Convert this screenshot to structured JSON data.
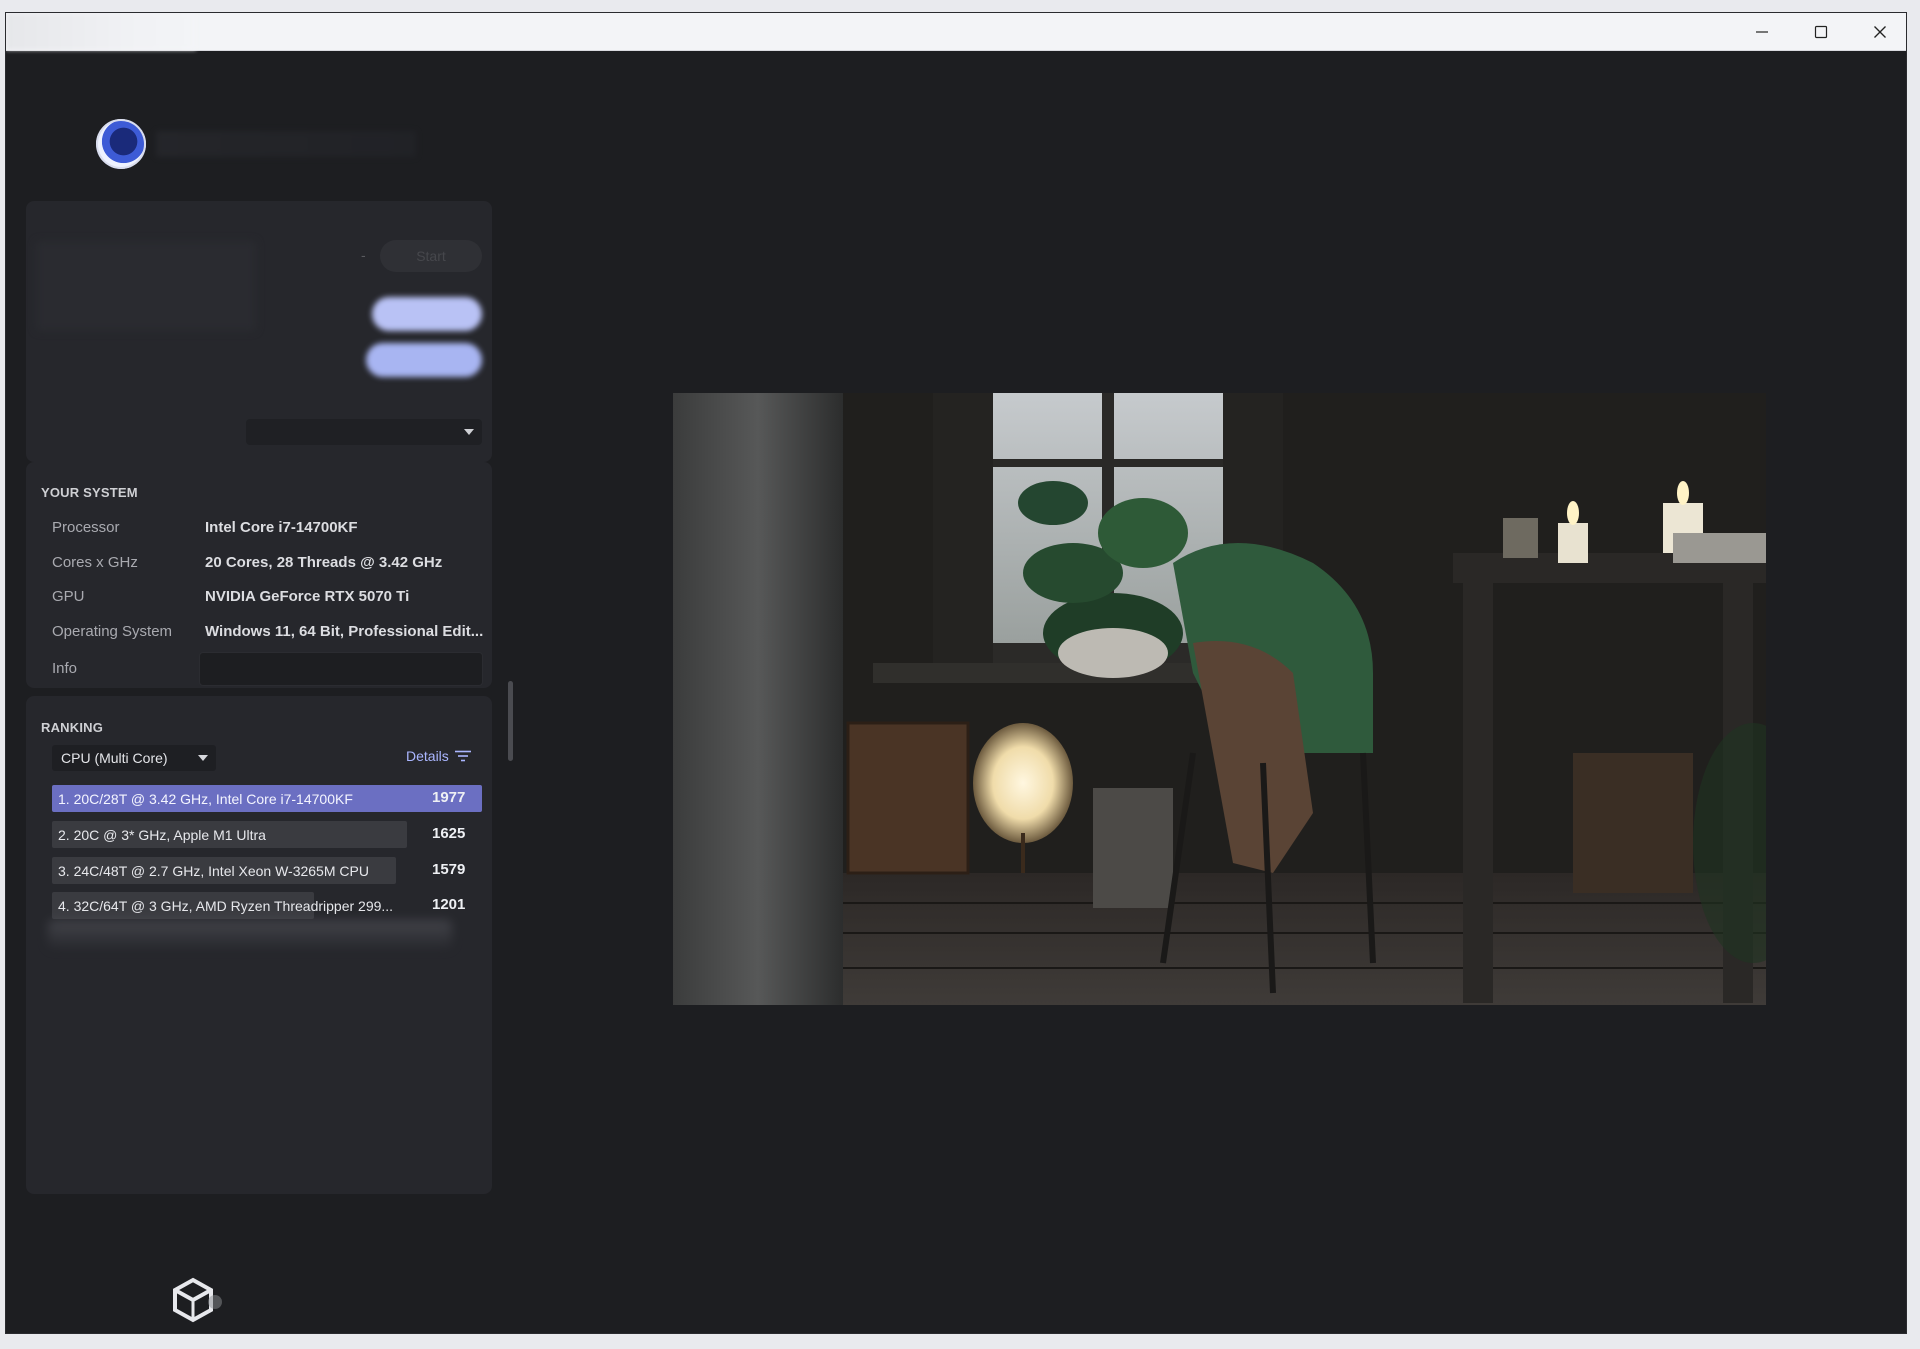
{
  "window": {
    "controls": {
      "minimize": "─",
      "maximize": "☐",
      "close": "✕"
    }
  },
  "controls_panel": {
    "dash": "-",
    "start_label": "Start"
  },
  "system": {
    "title": "YOUR SYSTEM",
    "rows": [
      {
        "label": "Processor",
        "value": "Intel Core i7-14700KF"
      },
      {
        "label": "Cores x GHz",
        "value": "20 Cores, 28 Threads @ 3.42 GHz"
      },
      {
        "label": "GPU",
        "value": "NVIDIA GeForce RTX 5070 Ti"
      },
      {
        "label": "Operating System",
        "value": "Windows 11, 64 Bit, Professional Edit..."
      },
      {
        "label": "Info",
        "value": ""
      }
    ]
  },
  "ranking": {
    "title": "RANKING",
    "mode": "CPU (Multi Core)",
    "details_label": "Details",
    "entries": [
      {
        "text": "1. 20C/28T @ 3.42 GHz, Intel Core i7-14700KF",
        "score": "1977",
        "score_value": 1977,
        "selected": true
      },
      {
        "text": "2. 20C @ 3* GHz, Apple M1 Ultra",
        "score": "1625",
        "score_value": 1625,
        "selected": false
      },
      {
        "text": "3. 24C/48T @ 2.7 GHz, Intel Xeon W-3265M CPU",
        "score": "1579",
        "score_value": 1579,
        "selected": false
      },
      {
        "text": "4. 32C/64T @ 3 GHz, AMD Ryzen Threadripper 299...",
        "score": "1201",
        "score_value": 1201,
        "selected": false
      }
    ]
  },
  "colors": {
    "background": "#1d1e21",
    "panel": "#26272c",
    "selected_row": "#6b6fc2",
    "row": "#3a3b40",
    "accent_link": "#aab6ff"
  }
}
